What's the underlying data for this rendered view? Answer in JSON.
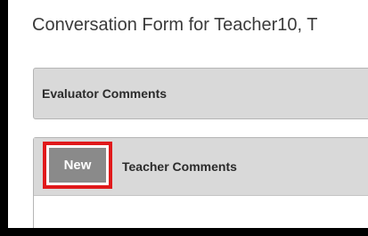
{
  "page": {
    "title": "Conversation Form for Teacher10, T"
  },
  "sections": {
    "evaluator": {
      "label": "Evaluator Comments"
    },
    "teacher": {
      "label": "Teacher Comments",
      "new_button_label": "New"
    }
  },
  "colors": {
    "highlight": "#e0191b",
    "header_bg": "#d9d9d9",
    "button_bg": "#8a8a8a"
  }
}
